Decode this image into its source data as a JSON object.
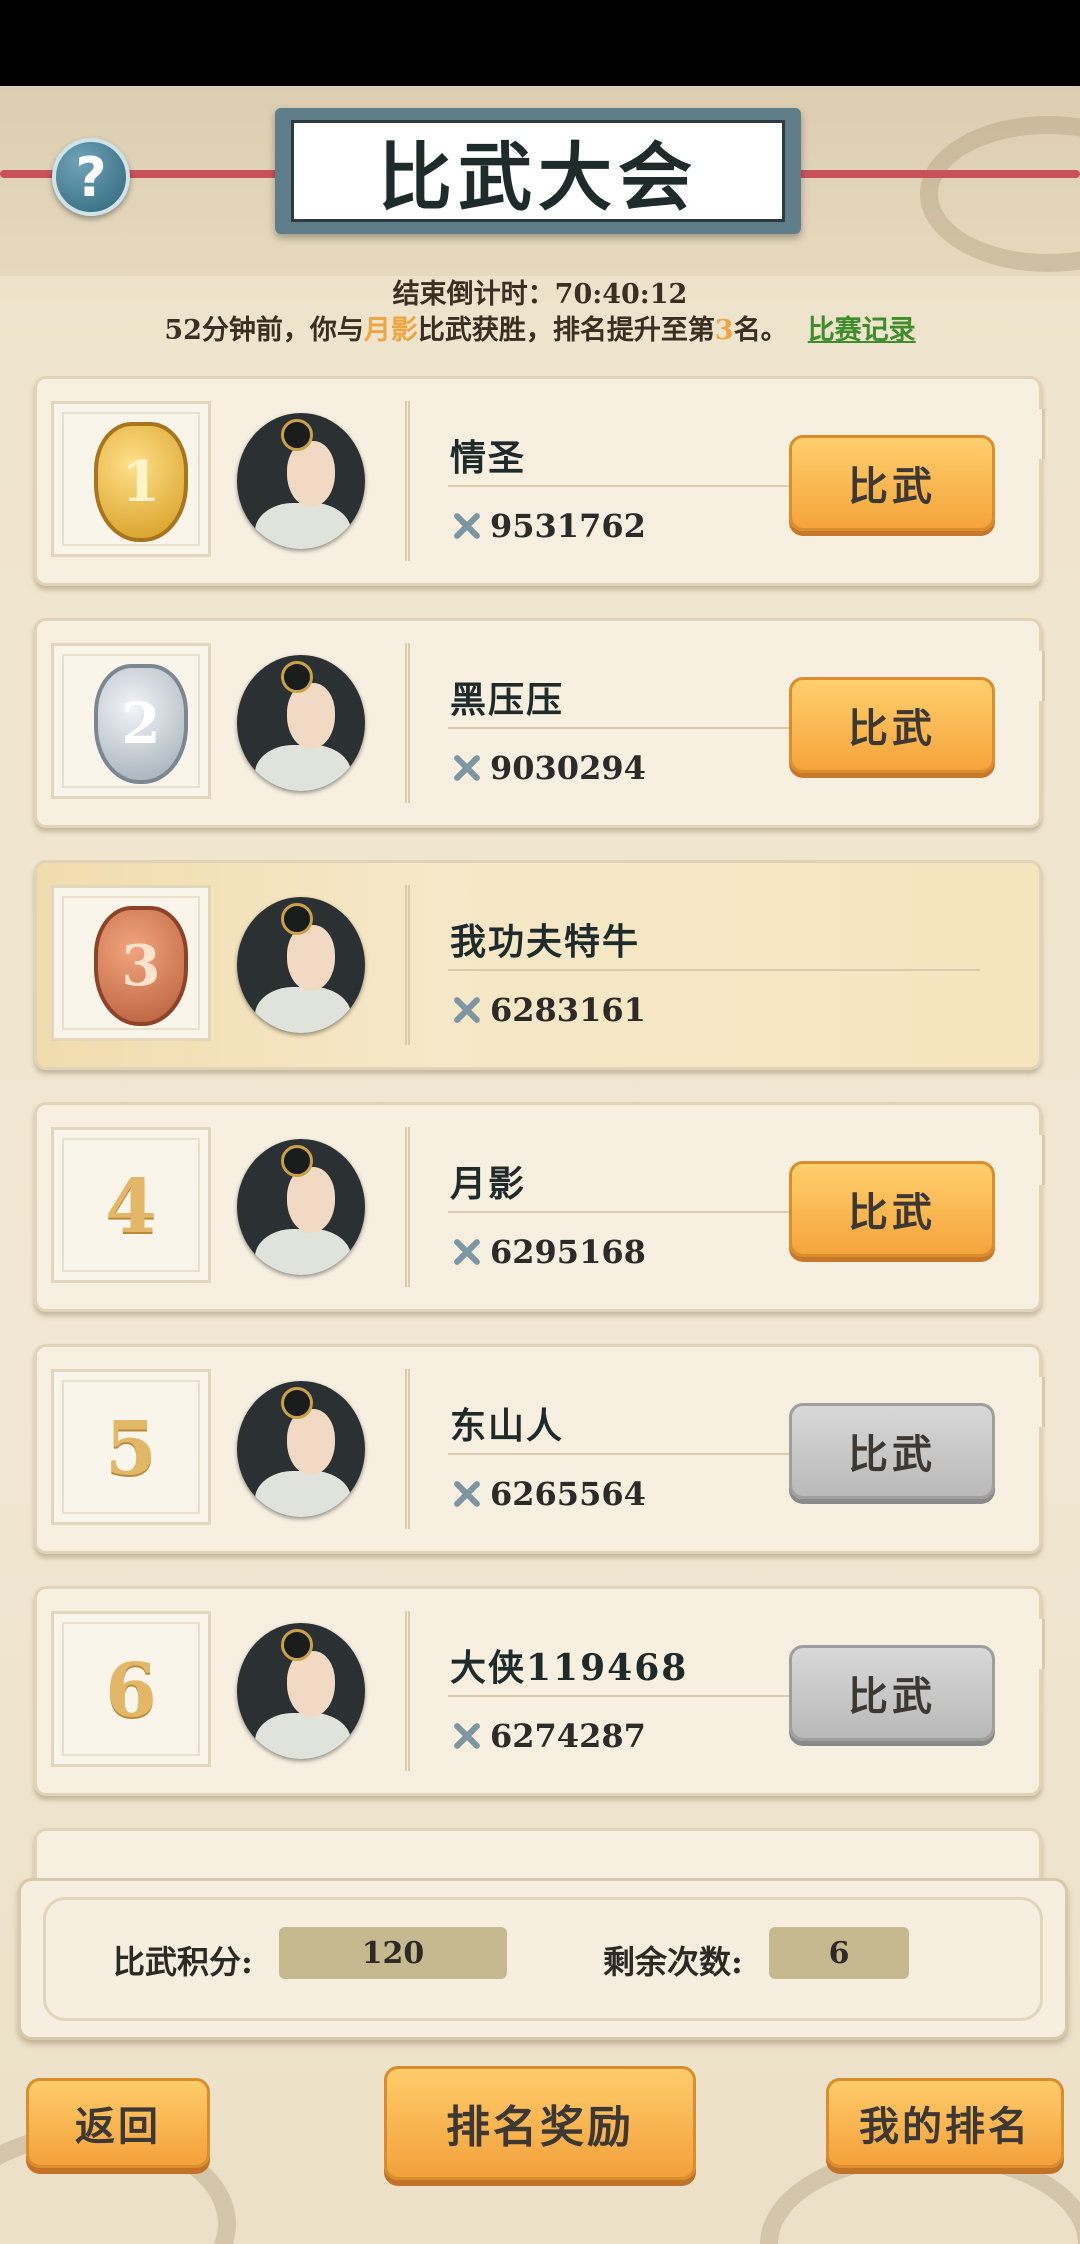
{
  "header": {
    "title": "比武大会",
    "help_icon": "question-mark-icon",
    "countdown": "结束倒计时：70:40:12",
    "news": {
      "prefix": "52分钟前，你与",
      "opponent": "月影",
      "middle": "比武获胜，排名提升至第",
      "rank": "3",
      "suffix": "名。",
      "record_link": "比赛记录"
    }
  },
  "ranking": [
    {
      "rank": "1",
      "badge": "gold-medal",
      "name": "情圣",
      "power": "9531762",
      "button": "比武",
      "button_enabled": true
    },
    {
      "rank": "2",
      "badge": "silver-medal",
      "name": "黑压压",
      "power": "9030294",
      "button": "比武",
      "button_enabled": true
    },
    {
      "rank": "3",
      "badge": "bronze-medal",
      "name": "我功夫特牛",
      "power": "6283161",
      "is_self": true
    },
    {
      "rank": "4",
      "name": "月影",
      "power": "6295168",
      "button": "比武",
      "button_enabled": true
    },
    {
      "rank": "5",
      "name": "东山人",
      "power": "6265564",
      "button": "比武",
      "button_enabled": false
    },
    {
      "rank": "6",
      "name": "大侠119468",
      "power": "6274287",
      "button": "比武",
      "button_enabled": false
    }
  ],
  "stats": {
    "score_label": "比武积分:",
    "score_value": "120",
    "remaining_label": "剩余次数:",
    "remaining_value": "6"
  },
  "footer": {
    "back": "返回",
    "rewards": "排名奖励",
    "my_rank": "我的排名"
  },
  "colors": {
    "accent_orange": "#f5a43b",
    "highlight": "#f0a640",
    "link_green": "#3f8e2c",
    "disabled_gray": "#b9b9b9"
  }
}
